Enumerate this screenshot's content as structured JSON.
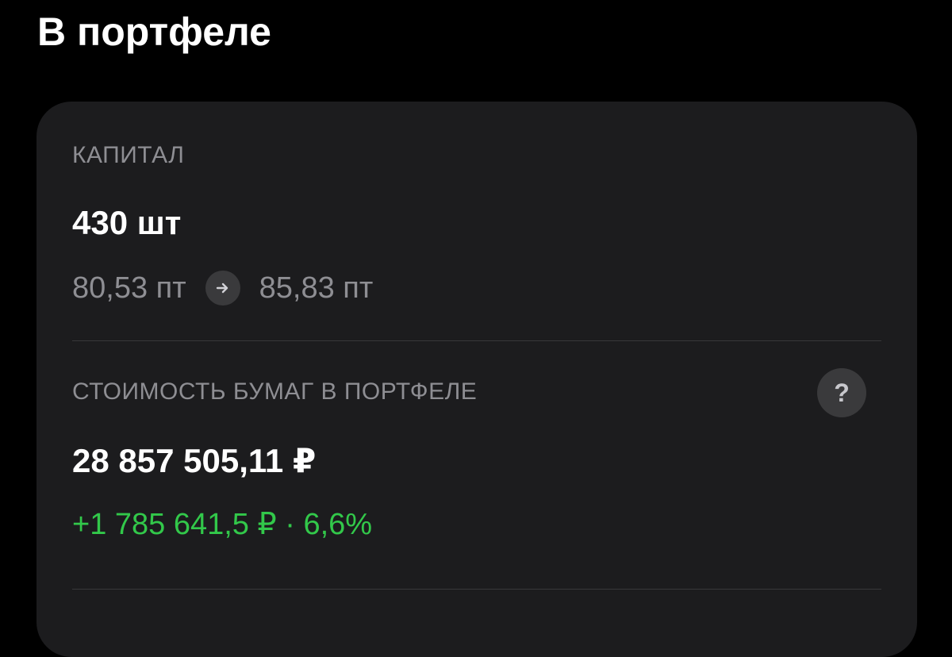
{
  "page": {
    "title": "В портфеле"
  },
  "capital": {
    "label": "КАПИТАЛ",
    "quantity": "430 шт",
    "price_from": "80,53 пт",
    "price_to": "85,83 пт",
    "arrow_icon": "arrow-right-icon"
  },
  "holdings_value": {
    "label": "СТОИМОСТЬ БУМАГ В ПОРТФЕЛЕ",
    "help_label": "?",
    "amount": "28 857 505,11 ₽",
    "change": "+1 785 641,5 ₽ · 6,6%"
  },
  "colors": {
    "background": "#000000",
    "card": "#1c1c1e",
    "secondary_text": "#8e8e93",
    "positive": "#32c84a"
  }
}
